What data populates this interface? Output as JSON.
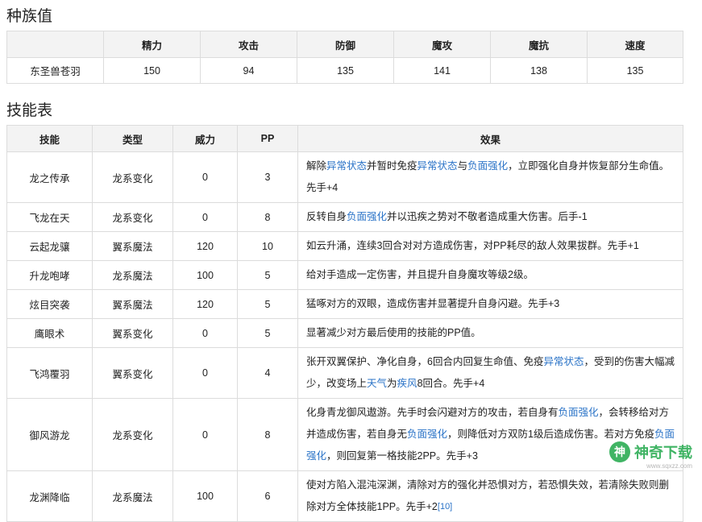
{
  "stats": {
    "title": "种族值",
    "headers": [
      "",
      "精力",
      "攻击",
      "防御",
      "魔攻",
      "魔抗",
      "速度"
    ],
    "row": [
      "东圣兽苍羽",
      "150",
      "94",
      "135",
      "141",
      "138",
      "135"
    ]
  },
  "skills": {
    "title": "技能表",
    "headers": [
      "技能",
      "类型",
      "威力",
      "PP",
      "效果"
    ],
    "rows": [
      {
        "name": "龙之传承",
        "type": "龙系变化",
        "power": "0",
        "pp": "3",
        "effect": [
          [
            "解除",
            ""
          ],
          [
            "异常状态",
            "link"
          ],
          [
            "并暂时免疫",
            ""
          ],
          [
            "异常状态",
            "link"
          ],
          [
            "与",
            ""
          ],
          [
            "负面强化",
            "link"
          ],
          [
            "，立即强化自身并恢复部分生命值。先手+4",
            ""
          ]
        ]
      },
      {
        "name": "飞龙在天",
        "type": "龙系变化",
        "power": "0",
        "pp": "8",
        "effect": [
          [
            "反转自身",
            ""
          ],
          [
            "负面强化",
            "link"
          ],
          [
            "并以迅疾之势对不敬者造成重大伤害。后手-1",
            ""
          ]
        ]
      },
      {
        "name": "云起龙骧",
        "type": "翼系魔法",
        "power": "120",
        "pp": "10",
        "effect": [
          [
            "如云升涌，连续3回合对对方造成伤害，对PP耗尽的敌人效果拔群。先手+1",
            ""
          ]
        ]
      },
      {
        "name": "升龙咆哮",
        "type": "龙系魔法",
        "power": "100",
        "pp": "5",
        "effect": [
          [
            "给对手造成一定伤害，并且提升自身魔攻等级2级。",
            ""
          ]
        ]
      },
      {
        "name": "炫目突袭",
        "type": "翼系魔法",
        "power": "120",
        "pp": "5",
        "effect": [
          [
            "猛啄对方的双眼，造成伤害并显著提升自身闪避。先手+3",
            ""
          ]
        ]
      },
      {
        "name": "鹰眼术",
        "type": "翼系变化",
        "power": "0",
        "pp": "5",
        "effect": [
          [
            "显著减少对方最后使用的技能的PP值。",
            ""
          ]
        ]
      },
      {
        "name": "飞鸿覆羽",
        "type": "翼系变化",
        "power": "0",
        "pp": "4",
        "effect": [
          [
            "张开双翼保护、净化自身，6回合内回复生命值、免疫",
            ""
          ],
          [
            "异常状态",
            "link"
          ],
          [
            "，受到的伤害大幅减少，改变场上",
            ""
          ],
          [
            "天气",
            "link"
          ],
          [
            "为",
            ""
          ],
          [
            "疾风",
            "link"
          ],
          [
            "8回合。先手+4",
            ""
          ]
        ]
      },
      {
        "name": "御风游龙",
        "type": "龙系变化",
        "power": "0",
        "pp": "8",
        "effect": [
          [
            "化身青龙御风遨游。先手时会闪避对方的攻击，若自身有",
            ""
          ],
          [
            "负面强化",
            "link"
          ],
          [
            "，会转移给对方并造成伤害，若自身无",
            ""
          ],
          [
            "负面强化",
            "link"
          ],
          [
            "，则降低对方双防1级后造成伤害。若对方免疫",
            ""
          ],
          [
            "负面强化",
            "link"
          ],
          [
            "，则回复第一格技能2PP。先手+3",
            ""
          ]
        ]
      },
      {
        "name": "龙渊降临",
        "type": "龙系魔法",
        "power": "100",
        "pp": "6",
        "effect": [
          [
            "使对方陷入混沌深渊，清除对方的强化并恐惧对方，若恐惧失效，若清除失败则删除对方全体技能1PP。先手+2",
            ""
          ],
          [
            "[10]",
            "ref"
          ]
        ]
      }
    ]
  },
  "watermark": {
    "logo_glyph": "神",
    "text": "神奇下载",
    "sub": "www.sqxzz.com",
    "color": "#1fa84a"
  }
}
